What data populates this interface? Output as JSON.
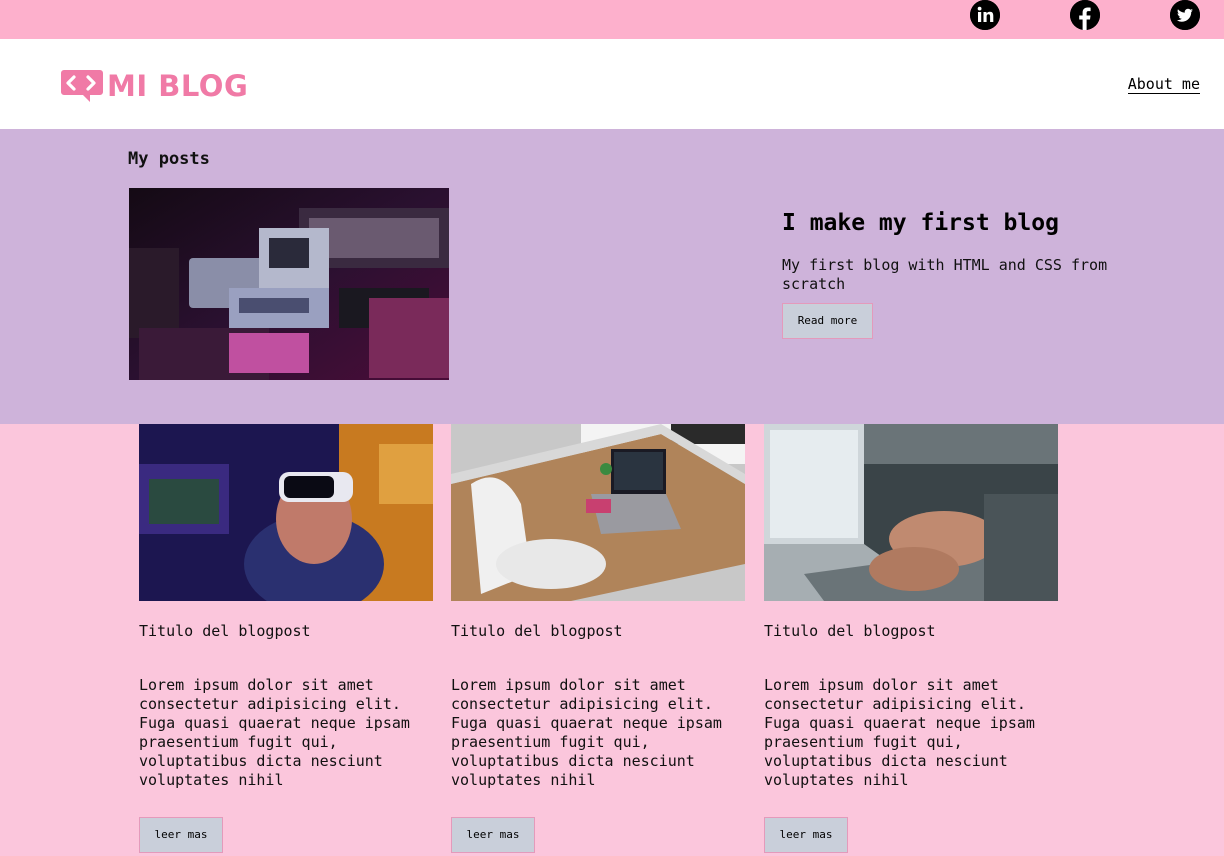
{
  "social": [
    {
      "name": "linkedin-icon"
    },
    {
      "name": "facebook-icon"
    },
    {
      "name": "twitter-icon"
    }
  ],
  "header": {
    "logo_text": "MI BLOG",
    "nav_about": "About me"
  },
  "featured": {
    "section_title": "My posts",
    "title": "I make my first blog",
    "description": "My first blog with HTML and CSS from scratch",
    "button_label": "Read more"
  },
  "cards": [
    {
      "title": "Titulo del blogpost",
      "description": "Lorem ipsum dolor sit amet consectetur adipisicing elit. Fuga quasi quaerat neque ipsam praesentium fugit qui, voluptatibus dicta nesciunt voluptates nihil",
      "button_label": "leer mas"
    },
    {
      "title": "Titulo del blogpost",
      "description": "Lorem ipsum dolor sit amet consectetur adipisicing elit. Fuga quasi quaerat neque ipsam praesentium fugit qui, voluptatibus dicta nesciunt voluptates nihil",
      "button_label": "leer mas"
    },
    {
      "title": "Titulo del blogpost",
      "description": "Lorem ipsum dolor sit amet consectetur adipisicing elit. Fuga quasi quaerat neque ipsam praesentium fugit qui, voluptatibus dicta nesciunt voluptates nihil",
      "button_label": "leer mas"
    }
  ],
  "colors": {
    "topbar": "#fdb0cc",
    "page_background": "#fbc6dc",
    "featured_background": "#ceb3da",
    "logo_pink": "#f07aa6",
    "button_background": "#c9cfda"
  }
}
